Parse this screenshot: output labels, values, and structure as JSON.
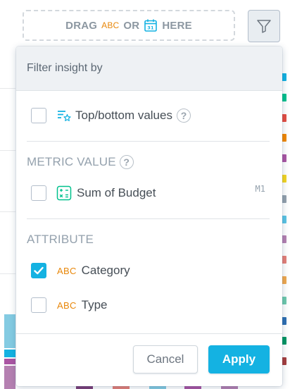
{
  "dropzone": {
    "prefix": "DRAG",
    "abc": "ABC",
    "middle": "OR",
    "suffix": "HERE"
  },
  "popover": {
    "header": "Filter insight by",
    "ranking": {
      "label": "Top/bottom values",
      "help": "?"
    },
    "metric_section": {
      "title": "METRIC VALUE",
      "help": "?"
    },
    "metric": {
      "label": "Sum of Budget",
      "id": "M1"
    },
    "attribute_section": {
      "title": "ATTRIBUTE"
    },
    "attributes": [
      {
        "tag": "ABC",
        "label": "Category",
        "checked": true
      },
      {
        "tag": "ABC",
        "label": "Type",
        "checked": false
      }
    ],
    "cancel_label": "Cancel",
    "apply_label": "Apply"
  },
  "colors": {
    "accent": "#14b2e2",
    "attribute_tag": "#e8870a"
  },
  "legend_colors": [
    "#14b2e2",
    "#00c18d",
    "#e54d42",
    "#f38700",
    "#ab55a3",
    "#f4d521",
    "#94a1ad",
    "#5bc4e4",
    "#b580b1",
    "#e57f78",
    "#f0a84f",
    "#6ec9ad",
    "#2e6fb2",
    "#009663",
    "#a63e3e"
  ],
  "bar_colors": [
    "#84cbe2",
    "#14b2e2",
    "#ab55a3",
    "#b580b1"
  ],
  "icons": [
    "filter-icon",
    "calendar-icon",
    "ranking-icon",
    "calculator-icon",
    "check-icon"
  ]
}
